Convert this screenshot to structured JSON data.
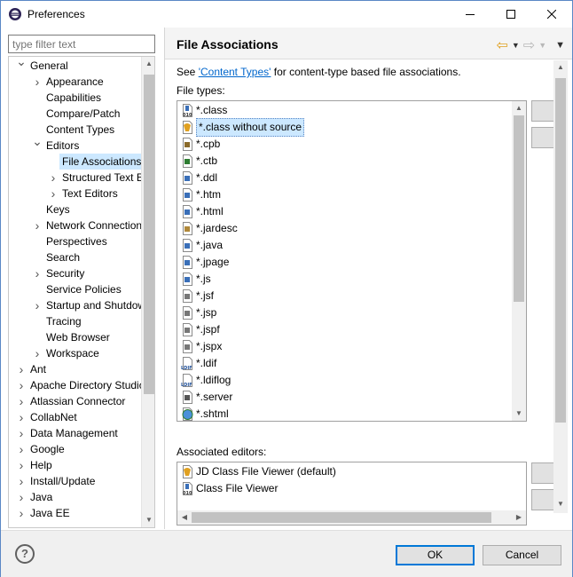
{
  "window": {
    "title": "Preferences"
  },
  "filter": {
    "placeholder": "type filter text"
  },
  "tree": [
    {
      "label": "General",
      "depth": 0,
      "expander": "open"
    },
    {
      "label": "Appearance",
      "depth": 1,
      "expander": "closed"
    },
    {
      "label": "Capabilities",
      "depth": 1,
      "expander": "none"
    },
    {
      "label": "Compare/Patch",
      "depth": 1,
      "expander": "none"
    },
    {
      "label": "Content Types",
      "depth": 1,
      "expander": "none"
    },
    {
      "label": "Editors",
      "depth": 1,
      "expander": "open"
    },
    {
      "label": "File Associations",
      "depth": 2,
      "expander": "none",
      "selected": true
    },
    {
      "label": "Structured Text E",
      "depth": 2,
      "expander": "closed"
    },
    {
      "label": "Text Editors",
      "depth": 2,
      "expander": "closed"
    },
    {
      "label": "Keys",
      "depth": 1,
      "expander": "none"
    },
    {
      "label": "Network Connection",
      "depth": 1,
      "expander": "closed"
    },
    {
      "label": "Perspectives",
      "depth": 1,
      "expander": "none"
    },
    {
      "label": "Search",
      "depth": 1,
      "expander": "none"
    },
    {
      "label": "Security",
      "depth": 1,
      "expander": "closed"
    },
    {
      "label": "Service Policies",
      "depth": 1,
      "expander": "none"
    },
    {
      "label": "Startup and Shutdow",
      "depth": 1,
      "expander": "closed"
    },
    {
      "label": "Tracing",
      "depth": 1,
      "expander": "none"
    },
    {
      "label": "Web Browser",
      "depth": 1,
      "expander": "none"
    },
    {
      "label": "Workspace",
      "depth": 1,
      "expander": "closed"
    },
    {
      "label": "Ant",
      "depth": 0,
      "expander": "closed"
    },
    {
      "label": "Apache Directory Studio",
      "depth": 0,
      "expander": "closed"
    },
    {
      "label": "Atlassian Connector",
      "depth": 0,
      "expander": "closed"
    },
    {
      "label": "CollabNet",
      "depth": 0,
      "expander": "closed"
    },
    {
      "label": "Data Management",
      "depth": 0,
      "expander": "closed"
    },
    {
      "label": "Google",
      "depth": 0,
      "expander": "closed"
    },
    {
      "label": "Help",
      "depth": 0,
      "expander": "closed"
    },
    {
      "label": "Install/Update",
      "depth": 0,
      "expander": "closed"
    },
    {
      "label": "Java",
      "depth": 0,
      "expander": "closed"
    },
    {
      "label": "Java EE",
      "depth": 0,
      "expander": "closed"
    }
  ],
  "page": {
    "title": "File Associations",
    "see_prefix": "See ",
    "see_link": "'Content Types'",
    "see_suffix": " for content-type based file associations.",
    "file_types_label": "File types:",
    "associated_editors_label": "Associated editors:"
  },
  "file_types": [
    {
      "name": "*.class",
      "icon": "class-file-icon",
      "color": "#3a6fb8"
    },
    {
      "name": "*.class without source",
      "icon": "class-nosource-icon",
      "color": "#e0a020",
      "selected": true
    },
    {
      "name": "*.cpb",
      "icon": "pencil-file-icon",
      "color": "#8a6a2a"
    },
    {
      "name": "*.ctb",
      "icon": "table-file-icon",
      "color": "#2e7d32"
    },
    {
      "name": "*.ddl",
      "icon": "database-file-icon",
      "color": "#3a6fb8"
    },
    {
      "name": "*.htm",
      "icon": "html-file-icon",
      "color": "#3a6fb8"
    },
    {
      "name": "*.html",
      "icon": "html-file-icon",
      "color": "#3a6fb8"
    },
    {
      "name": "*.jardesc",
      "icon": "jar-file-icon",
      "color": "#b0883a"
    },
    {
      "name": "*.java",
      "icon": "java-file-icon",
      "color": "#3a6fb8"
    },
    {
      "name": "*.jpage",
      "icon": "java-file-icon",
      "color": "#3a6fb8"
    },
    {
      "name": "*.js",
      "icon": "js-file-icon",
      "color": "#3a6fb8"
    },
    {
      "name": "*.jsf",
      "icon": "text-file-icon",
      "color": "#777777"
    },
    {
      "name": "*.jsp",
      "icon": "text-file-icon",
      "color": "#777777"
    },
    {
      "name": "*.jspf",
      "icon": "text-file-icon",
      "color": "#777777"
    },
    {
      "name": "*.jspx",
      "icon": "text-file-icon",
      "color": "#777777"
    },
    {
      "name": "*.ldif",
      "icon": "ldif-file-icon",
      "color": "#1e4f9a"
    },
    {
      "name": "*.ldiflog",
      "icon": "ldif-file-icon",
      "color": "#1e4f9a"
    },
    {
      "name": "*.server",
      "icon": "server-file-icon",
      "color": "#555555"
    },
    {
      "name": "*.shtml",
      "icon": "globe-file-icon",
      "color": "#2e7d32"
    }
  ],
  "editors": [
    {
      "name": "JD Class File Viewer (default)",
      "icon": "class-nosource-icon",
      "color": "#e0a020"
    },
    {
      "name": "Class File Viewer",
      "icon": "class-file-icon",
      "color": "#3a6fb8"
    }
  ],
  "ldif_badge": "LDIF",
  "class_badge": "010",
  "buttons": {
    "ok": "OK",
    "cancel": "Cancel",
    "help": "?"
  }
}
